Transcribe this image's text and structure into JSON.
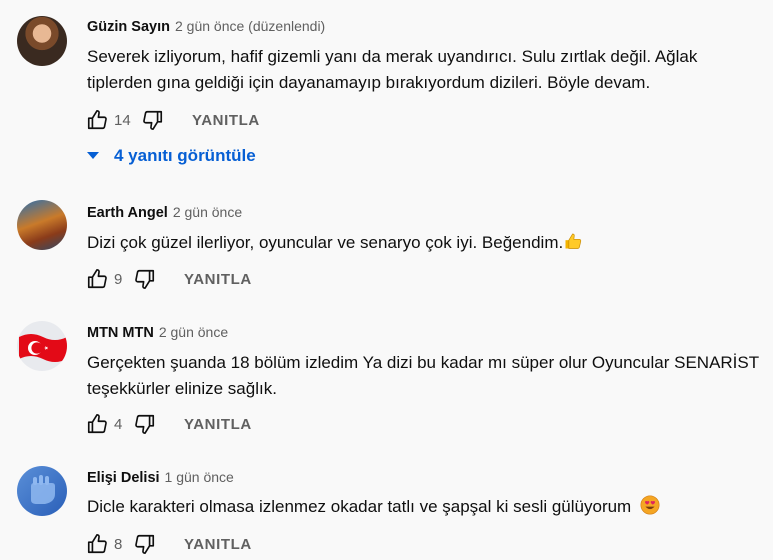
{
  "comments": [
    {
      "author": "Güzin Sayın",
      "time": "2 gün önce (düzenlendi)",
      "text_line1": "Severek izliyorum, hafif gizemli yanı da merak uyandırıcı. Sulu zırtlak değil. Ağlak",
      "text_line2": "tiplerden gına geldiği için dayanamayıp bırakıyordum dizileri. Böyle devam.",
      "likes": "14",
      "reply_label": "YANITLA",
      "view_replies": "4 yanıtı görüntüle"
    },
    {
      "author": "Earth Angel",
      "time": "2 gün önce",
      "text_line1": "Dizi çok güzel ilerliyor, oyuncular ve senaryo çok iyi. Beğendim.",
      "emoji": "thumbs-up-emoji",
      "likes": "9",
      "reply_label": "YANITLA"
    },
    {
      "author": "MTN MTN",
      "time": "2 gün önce",
      "text_line1": "Gerçekten şuanda 18 bölüm izledim Ya dizi bu kadar mı süper olur Oyuncular SENARİST",
      "text_line2": "teşekkürler elinize sağlık.",
      "likes": "4",
      "reply_label": "YANITLA"
    },
    {
      "author": "Elişi Delisi",
      "time": "1 gün önce",
      "text_line1": "Dicle karakteri olmasa izlenmez okadar tatlı ve şapşal ki sesli gülüyorum",
      "emoji": "heart-eyes-emoji",
      "likes": "8",
      "reply_label": "YANITLA"
    }
  ],
  "colors": {
    "link": "#065fd4",
    "secondary_text": "#606060",
    "background": "#f9f9f9"
  },
  "icons": {
    "like": "thumbs-up-icon",
    "dislike": "thumbs-down-icon",
    "expand": "caret-down-icon"
  }
}
